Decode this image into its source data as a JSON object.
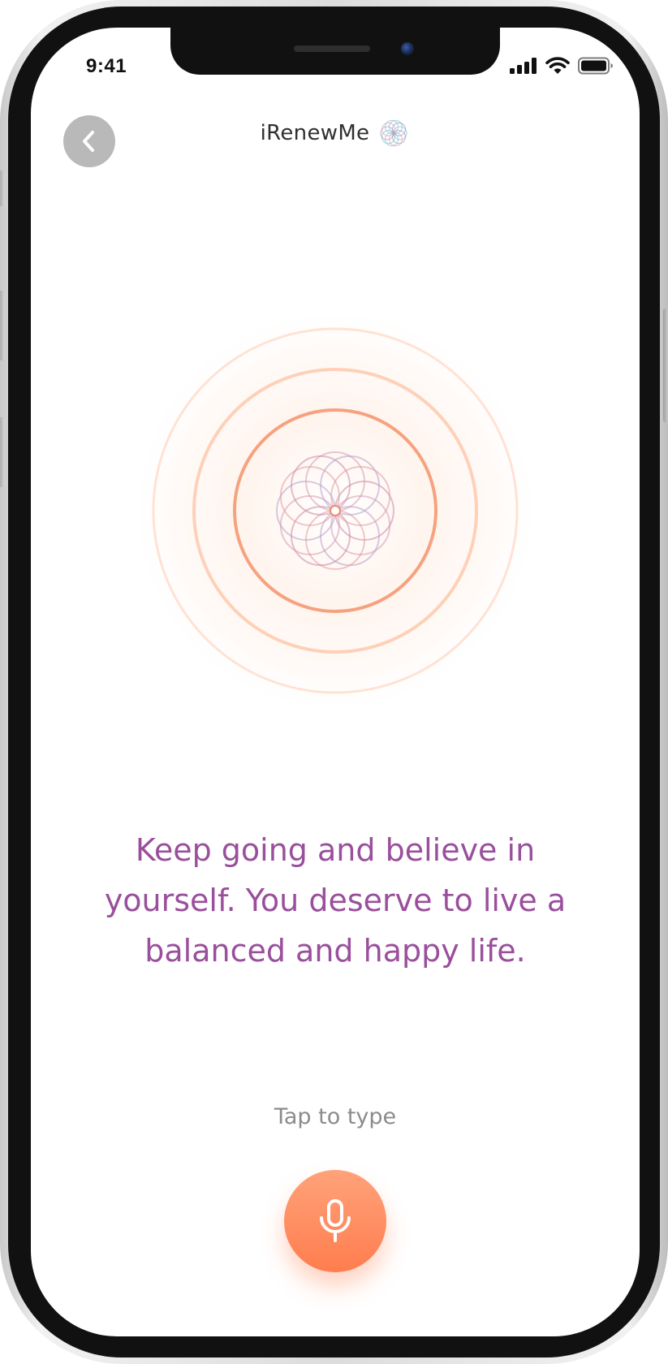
{
  "status_bar": {
    "time": "9:41",
    "icons": [
      "cellular-signal-icon",
      "wifi-icon",
      "battery-icon"
    ]
  },
  "header": {
    "back_icon": "chevron-left-icon",
    "brand_name": "iRenewMe",
    "brand_logo_icon": "mandala-logo-icon"
  },
  "main": {
    "affirmation": "Keep going and believe in yourself. You deserve to live a balanced and happy life.",
    "tap_to_type": "Tap to type",
    "mic_icon": "microphone-icon"
  },
  "colors": {
    "accent_orange": "#ff8a5c",
    "affirmation_purple": "#9a4f9c",
    "back_button_gray": "#b9b9b9",
    "muted_text": "#8b8b8b"
  }
}
